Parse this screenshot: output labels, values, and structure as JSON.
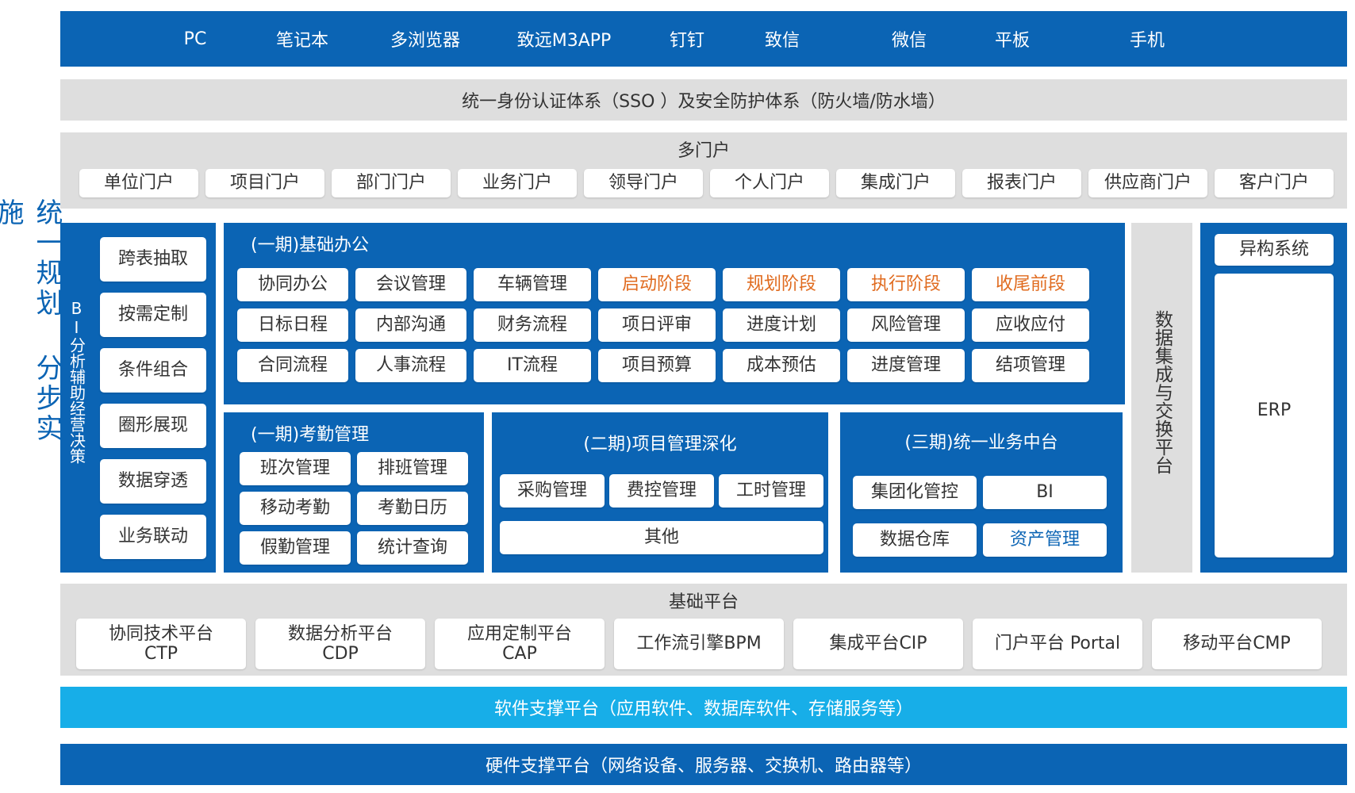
{
  "devices": [
    "PC",
    "笔记本",
    "多浏览器",
    "致远M3APP",
    "钉钉",
    "致信",
    "微信",
    "平板",
    "手机"
  ],
  "sso": "统一身份认证体系（SSO ）及安全防护体系（防火墙/防水墙）",
  "portals": {
    "title": "多门户",
    "items": [
      "单位门户",
      "项目门户",
      "部门门户",
      "业务门户",
      "领导门户",
      "个人门户",
      "集成门户",
      "报表门户",
      "供应商门户",
      "客户门户"
    ]
  },
  "side_title": "统一规划 分步实施",
  "bi": {
    "title": "BI分析辅助经营决策",
    "items": [
      "跨表抽取",
      "按需定制",
      "条件组合",
      "圈形展现",
      "数据穿透",
      "业务联动"
    ]
  },
  "basic_office": {
    "title": "(一期)基础办公",
    "rows": [
      [
        "协同办公",
        "会议管理",
        "车辆管理",
        "启动阶段",
        "规划阶段",
        "执行阶段",
        "收尾前段"
      ],
      [
        "日标日程",
        "内部沟通",
        "财务流程",
        "项日评审",
        "进度计划",
        "风险管理",
        "应收应付"
      ],
      [
        "合同流程",
        "人事流程",
        "IT流程",
        "项目预算",
        "成本预估",
        "进度管理",
        "结项管理"
      ]
    ]
  },
  "attendance": {
    "title": "(一期)考勤管理",
    "items": [
      "班次管理",
      "排班管理",
      "移动考勤",
      "考勤日历",
      "假勤管理",
      "统计查询"
    ]
  },
  "project_mgmt": {
    "title": "(二期)项目管理深化",
    "items": [
      "采购管理",
      "费控管理",
      "工时管理",
      "其他"
    ]
  },
  "business_center": {
    "title": "(三期)统一业务中台",
    "items": [
      "集团化管控",
      "BI",
      "数据仓库",
      "资产管理"
    ]
  },
  "data_integration": "数据集成与交换平台",
  "hetero": {
    "title": "异构系统",
    "erp": "ERP"
  },
  "base_platform": {
    "title": "基础平台",
    "items": [
      {
        "line1": "协同技术平台",
        "line2": "CTP"
      },
      {
        "line1": "数据分析平台",
        "line2": "CDP"
      },
      {
        "line1": "应用定制平台",
        "line2": "CAP"
      },
      {
        "line1": "工作流引擎BPM",
        "line2": ""
      },
      {
        "line1": "集成平台CIP",
        "line2": ""
      },
      {
        "line1": "门户平台 Portal",
        "line2": ""
      },
      {
        "line1": "移动平台CMP",
        "line2": ""
      }
    ]
  },
  "software_platform": "软件支撑平台（应用软件、数据库软件、存储服务等）",
  "hardware_platform": "硬件支撑平台（网络设备、服务器、交换机、路由器等）",
  "colors": {
    "primary_blue": "#0b64b4",
    "light_gray": "#dedede",
    "cyan": "#17aee8",
    "highlight_orange": "#e06b1f"
  }
}
